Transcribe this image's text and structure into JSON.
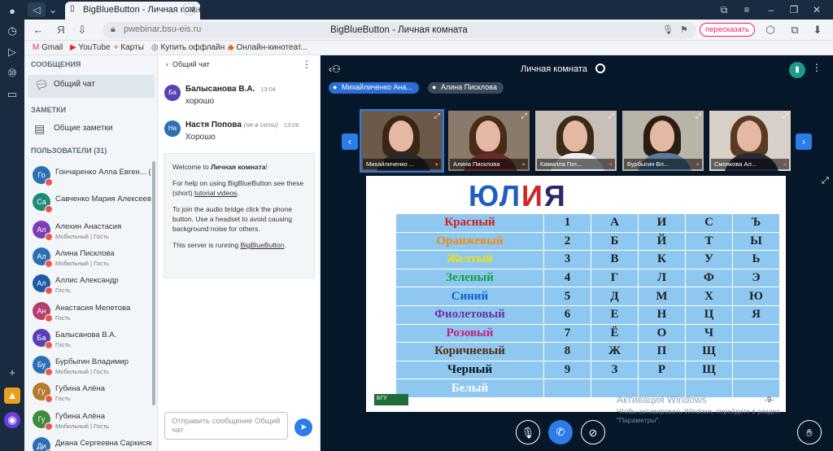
{
  "browser": {
    "tab_title": "BigBlueButton - Личная комната",
    "url": "pwebinar.bsu-eis.ru",
    "page_title": "BigBlueButton - Личная комната",
    "pereskazat": "пересказать",
    "bookmarks": [
      "Gmail",
      "YouTube",
      "Карты",
      "Купить оффлайн ...",
      "Онлайн-кинотеат..."
    ]
  },
  "sidebar": {
    "messages_header": "СООБЩЕНИЯ",
    "public_chat": "Общий чат",
    "notes_header": "ЗАМЕТКИ",
    "shared_notes": "Общие заметки",
    "users_header": "ПОЛЬЗОВАТЕЛИ (31)",
    "users": [
      {
        "initials": "Го",
        "name": "Гончаренко Алла Евген... (Вы)",
        "status": "",
        "color": "#2d6fb5"
      },
      {
        "initials": "Са",
        "name": "Савченко Мария Алексеевна",
        "status": "",
        "color": "#1f8a7a"
      },
      {
        "initials": "Ал",
        "name": "Алехин Анастасия",
        "status": "Мобильный | Гость",
        "color": "#7a3fb5"
      },
      {
        "initials": "Ал",
        "name": "Алина Писклова",
        "status": "Мобильный | Гость",
        "color": "#2d6fb5"
      },
      {
        "initials": "Ал",
        "name": "Аллис Александр",
        "status": "Гость",
        "color": "#1f5aa8"
      },
      {
        "initials": "Ан",
        "name": "Анастасия Мелетова",
        "status": "Гость",
        "color": "#b53f6f"
      },
      {
        "initials": "Ба",
        "name": "Балысанова В.А.",
        "status": "Гость",
        "color": "#5a3fb5"
      },
      {
        "initials": "Бу",
        "name": "Бурбыгин Владимир",
        "status": "Мобильный | Гость",
        "color": "#2d6fb5"
      },
      {
        "initials": "Гу",
        "name": "Губина Алёна",
        "status": "Гость",
        "color": "#b57a2d"
      },
      {
        "initials": "Гу",
        "name": "Губина Алёна",
        "status": "Мобильный | Гость",
        "color": "#3f8a3f"
      },
      {
        "initials": "Ди",
        "name": "Диана Сергеевна Саркисян",
        "status": "",
        "color": "#2d6fb5"
      }
    ]
  },
  "chat": {
    "back_label": "Общий чат",
    "messages": [
      {
        "initials": "Ба",
        "name": "Балысанова В.А.",
        "time": "13:04",
        "text": "хорошо",
        "color": "#5a3fb5",
        "away": ""
      },
      {
        "initials": "На",
        "name": "Настя Попова",
        "time": "13:06",
        "text": "Хорошо",
        "color": "#2d6fb5",
        "away": "(не в сети)"
      }
    ],
    "welcome_title_prefix": "Welcome to ",
    "welcome_title_room": "Личная комната",
    "welcome_title_suffix": "!",
    "welcome_p1_prefix": "For help on using BigBlueButton see these (short) ",
    "welcome_p1_link": "tutorial videos",
    "welcome_p1_suffix": ".",
    "welcome_p2": "To join the audio bridge click the phone button. Use a headset to avoid causing background noise for others.",
    "welcome_p3_prefix": "This server is running ",
    "welcome_p3_link": "BigBlueButton",
    "welcome_p3_suffix": ".",
    "input_placeholder": "Отправить сообщение Общий чат"
  },
  "stage": {
    "room_title": "Личная комната",
    "talkers": [
      {
        "name": "Михайличенко Ана...",
        "color": "#2b6fd6"
      },
      {
        "name": "Алина Писклова",
        "color": "#3a4a5e"
      }
    ],
    "videos": [
      {
        "name": "Михайличенко ...",
        "hair": "#3b2418",
        "body": "#2a2a2a",
        "bg": "#6b5a4a"
      },
      {
        "name": "Алина Писклова",
        "hair": "#4a2a18",
        "body": "#6b2a2a",
        "bg": "#8a7a6a"
      },
      {
        "name": "Камилла Гол...",
        "hair": "#3a2a1a",
        "body": "#eeeeee",
        "bg": "#c8c0b8"
      },
      {
        "name": "Бурбыгин Вл...",
        "hair": "#2a1e14",
        "body": "#5a7a9a",
        "bg": "#b8b4a8"
      },
      {
        "name": "Смоякова Ал...",
        "hair": "#5a3a20",
        "body": "#2a2a3a",
        "bg": "#d8d0c8"
      }
    ],
    "slide_title_letters": [
      {
        "ch": "Ю",
        "color": "#1f5fc0"
      },
      {
        "ch": "Л",
        "color": "#1f5fc0"
      },
      {
        "ch": "И",
        "color": "#d42828"
      },
      {
        "ch": "Я",
        "color": "#2a2a6a"
      }
    ],
    "table_rows": [
      {
        "label": "Красный",
        "color": "#d42020",
        "cells": [
          "1",
          "А",
          "И",
          "С",
          "Ъ"
        ]
      },
      {
        "label": "Оранжевый",
        "color": "#f08a10",
        "cells": [
          "2",
          "Б",
          "Й",
          "Т",
          "Ы"
        ]
      },
      {
        "label": "Желтый",
        "color": "#f0e010",
        "cells": [
          "3",
          "В",
          "К",
          "У",
          "Ь"
        ]
      },
      {
        "label": "Зеленый",
        "color": "#10a040",
        "cells": [
          "4",
          "Г",
          "Л",
          "Ф",
          "Э"
        ]
      },
      {
        "label": "Синий",
        "color": "#1060d0",
        "cells": [
          "5",
          "Д",
          "М",
          "Х",
          "Ю"
        ]
      },
      {
        "label": "Фиолетовый",
        "color": "#7030a0",
        "cells": [
          "6",
          "Е",
          "Н",
          "Ц",
          "Я"
        ]
      },
      {
        "label": "Розовый",
        "color": "#c02080",
        "cells": [
          "7",
          "Ё",
          "О",
          "Ч",
          ""
        ]
      },
      {
        "label": "Коричневый",
        "color": "#5a2a10",
        "cells": [
          "8",
          "Ж",
          "П",
          "Щ",
          ""
        ]
      },
      {
        "label": "Черный",
        "color": "#111111",
        "cells": [
          "9",
          "З",
          "Р",
          "Щ",
          ""
        ]
      },
      {
        "label": "Белый",
        "color": "#ffffff",
        "cells": [
          "",
          "",
          "",
          "",
          ""
        ]
      }
    ],
    "page_number": "-9-",
    "logo_text": "БГУ",
    "activation_title": "Активация Windows",
    "activation_body": "Чтобы активировать Windows, перейдите в раздел \"Параметры\"."
  }
}
